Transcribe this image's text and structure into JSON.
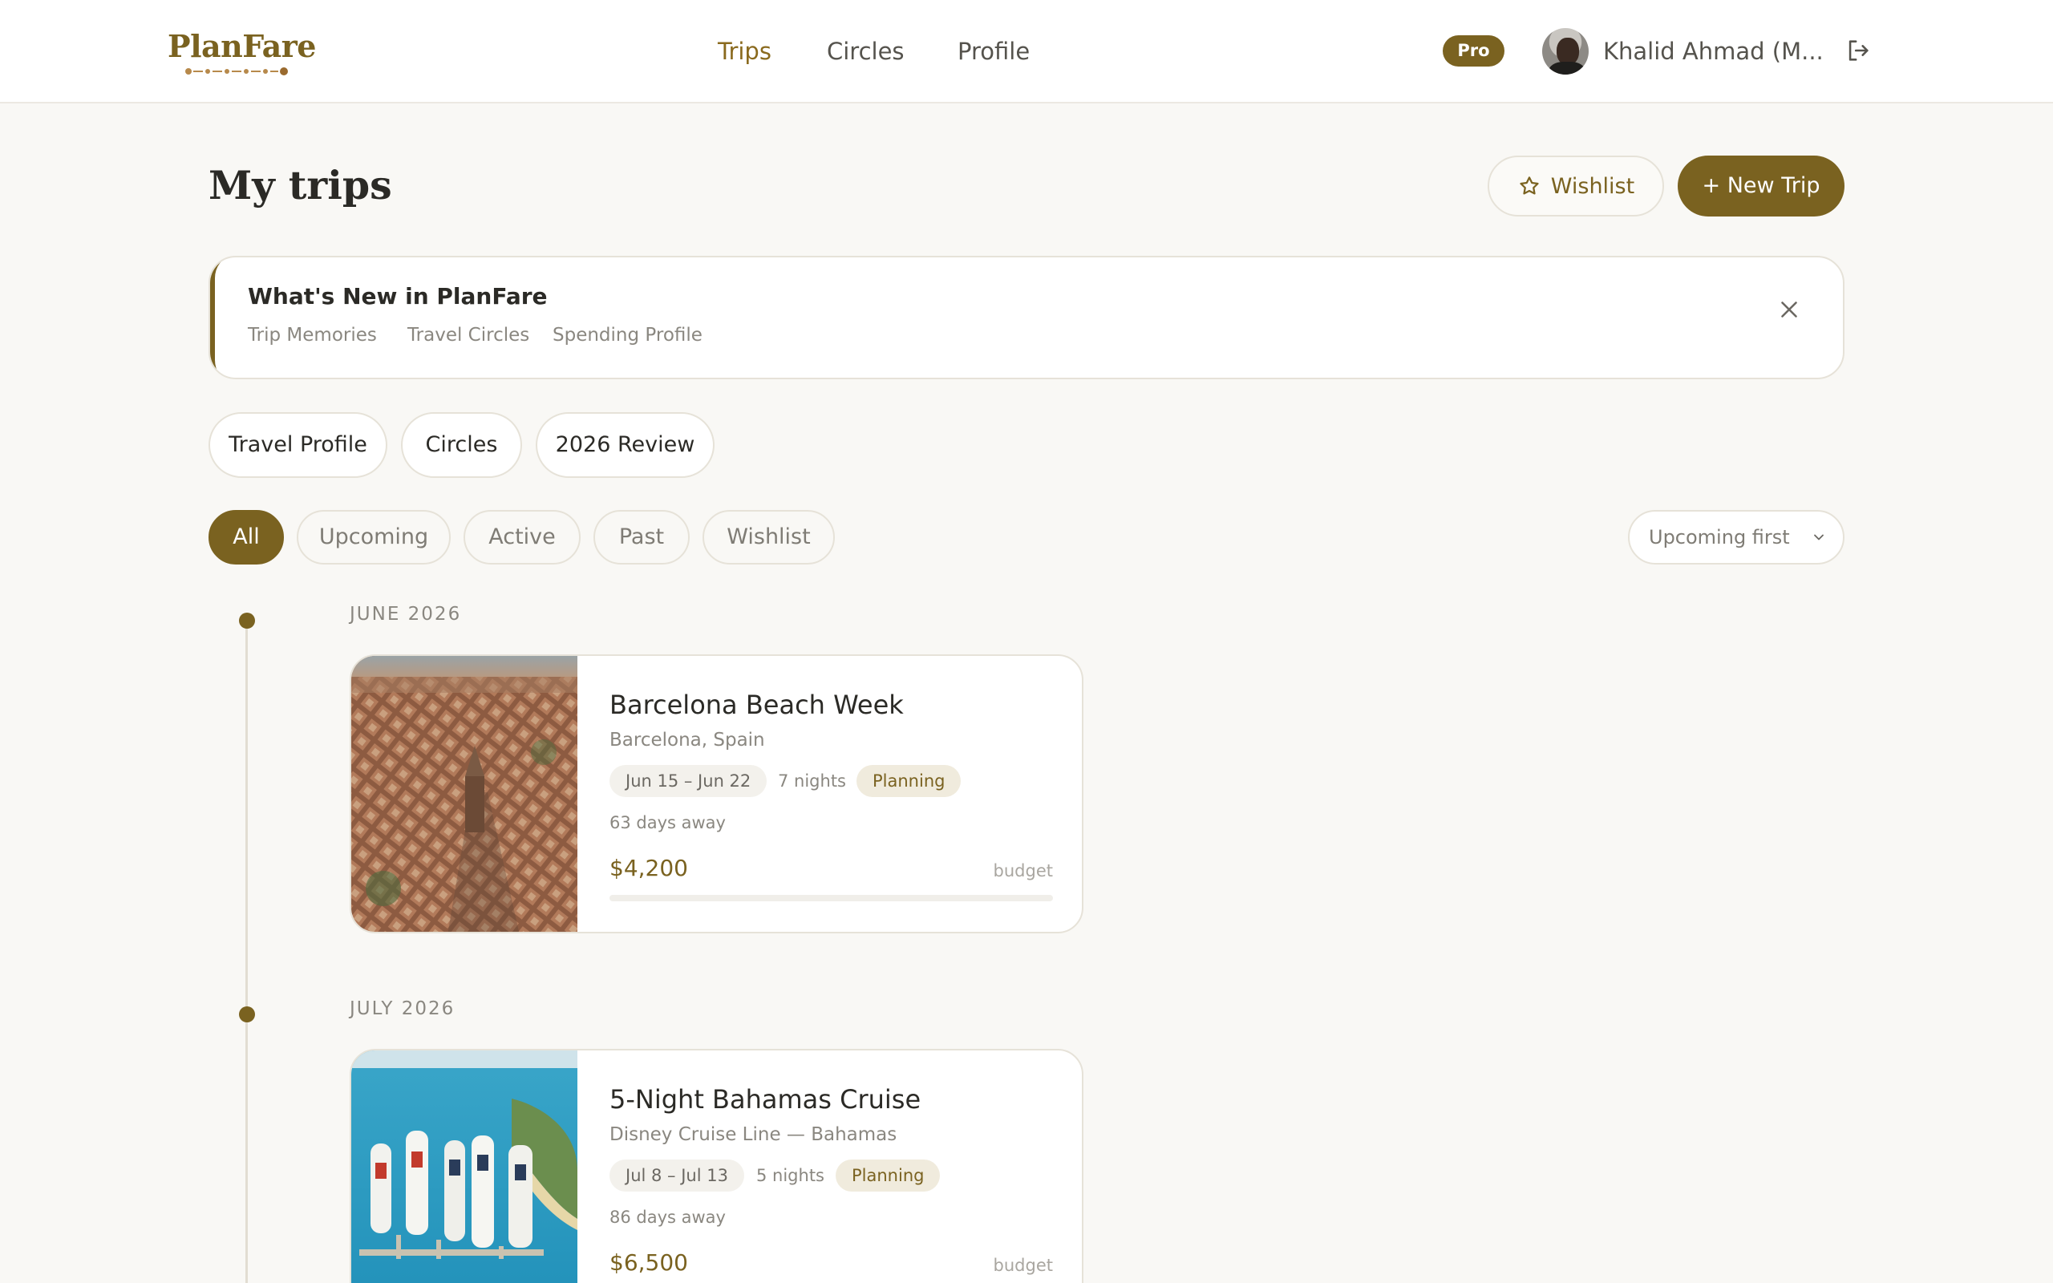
{
  "header": {
    "logo": "PlanFare",
    "nav": [
      {
        "label": "Trips",
        "active": true
      },
      {
        "label": "Circles",
        "active": false
      },
      {
        "label": "Profile",
        "active": false
      }
    ],
    "plan_badge": "Pro",
    "user_name": "Khalid Ahmad (M...",
    "icons": {
      "logout": "logout-icon"
    }
  },
  "page": {
    "title": "My trips",
    "wishlist_button": "Wishlist",
    "new_trip_button": "+ New Trip"
  },
  "announcement": {
    "title": "What's New in PlanFare",
    "links": [
      "Trip Memories",
      "Travel Circles",
      "Spending Profile"
    ]
  },
  "quick_links": [
    "Travel Profile",
    "Circles",
    "2026 Review"
  ],
  "filters": {
    "chips": [
      {
        "label": "All",
        "active": true
      },
      {
        "label": "Upcoming",
        "active": false
      },
      {
        "label": "Active",
        "active": false
      },
      {
        "label": "Past",
        "active": false
      },
      {
        "label": "Wishlist",
        "active": false
      }
    ],
    "sort": "Upcoming first"
  },
  "timeline": [
    {
      "month": "JUNE 2026",
      "trip": {
        "title": "Barcelona Beach Week",
        "location": "Barcelona, Spain",
        "dates": "Jun 15 – Jun 22",
        "nights": "7 nights",
        "status": "Planning",
        "countdown": "63 days away",
        "budget": "$4,200",
        "budget_label": "budget",
        "budget_progress": 0,
        "image": "barcelona-aerial"
      }
    },
    {
      "month": "JULY 2026",
      "trip": {
        "title": "5-Night Bahamas Cruise",
        "location": "Disney Cruise Line — Bahamas",
        "dates": "Jul 8 – Jul 13",
        "nights": "5 nights",
        "status": "Planning",
        "countdown": "86 days away",
        "budget": "$6,500",
        "budget_label": "budget",
        "budget_progress": 0,
        "image": "bahamas-cruise-port"
      }
    }
  ],
  "colors": {
    "accent": "#7a6220",
    "background": "#f9f8f5",
    "card": "#ffffff",
    "border": "#e6e2d8"
  }
}
